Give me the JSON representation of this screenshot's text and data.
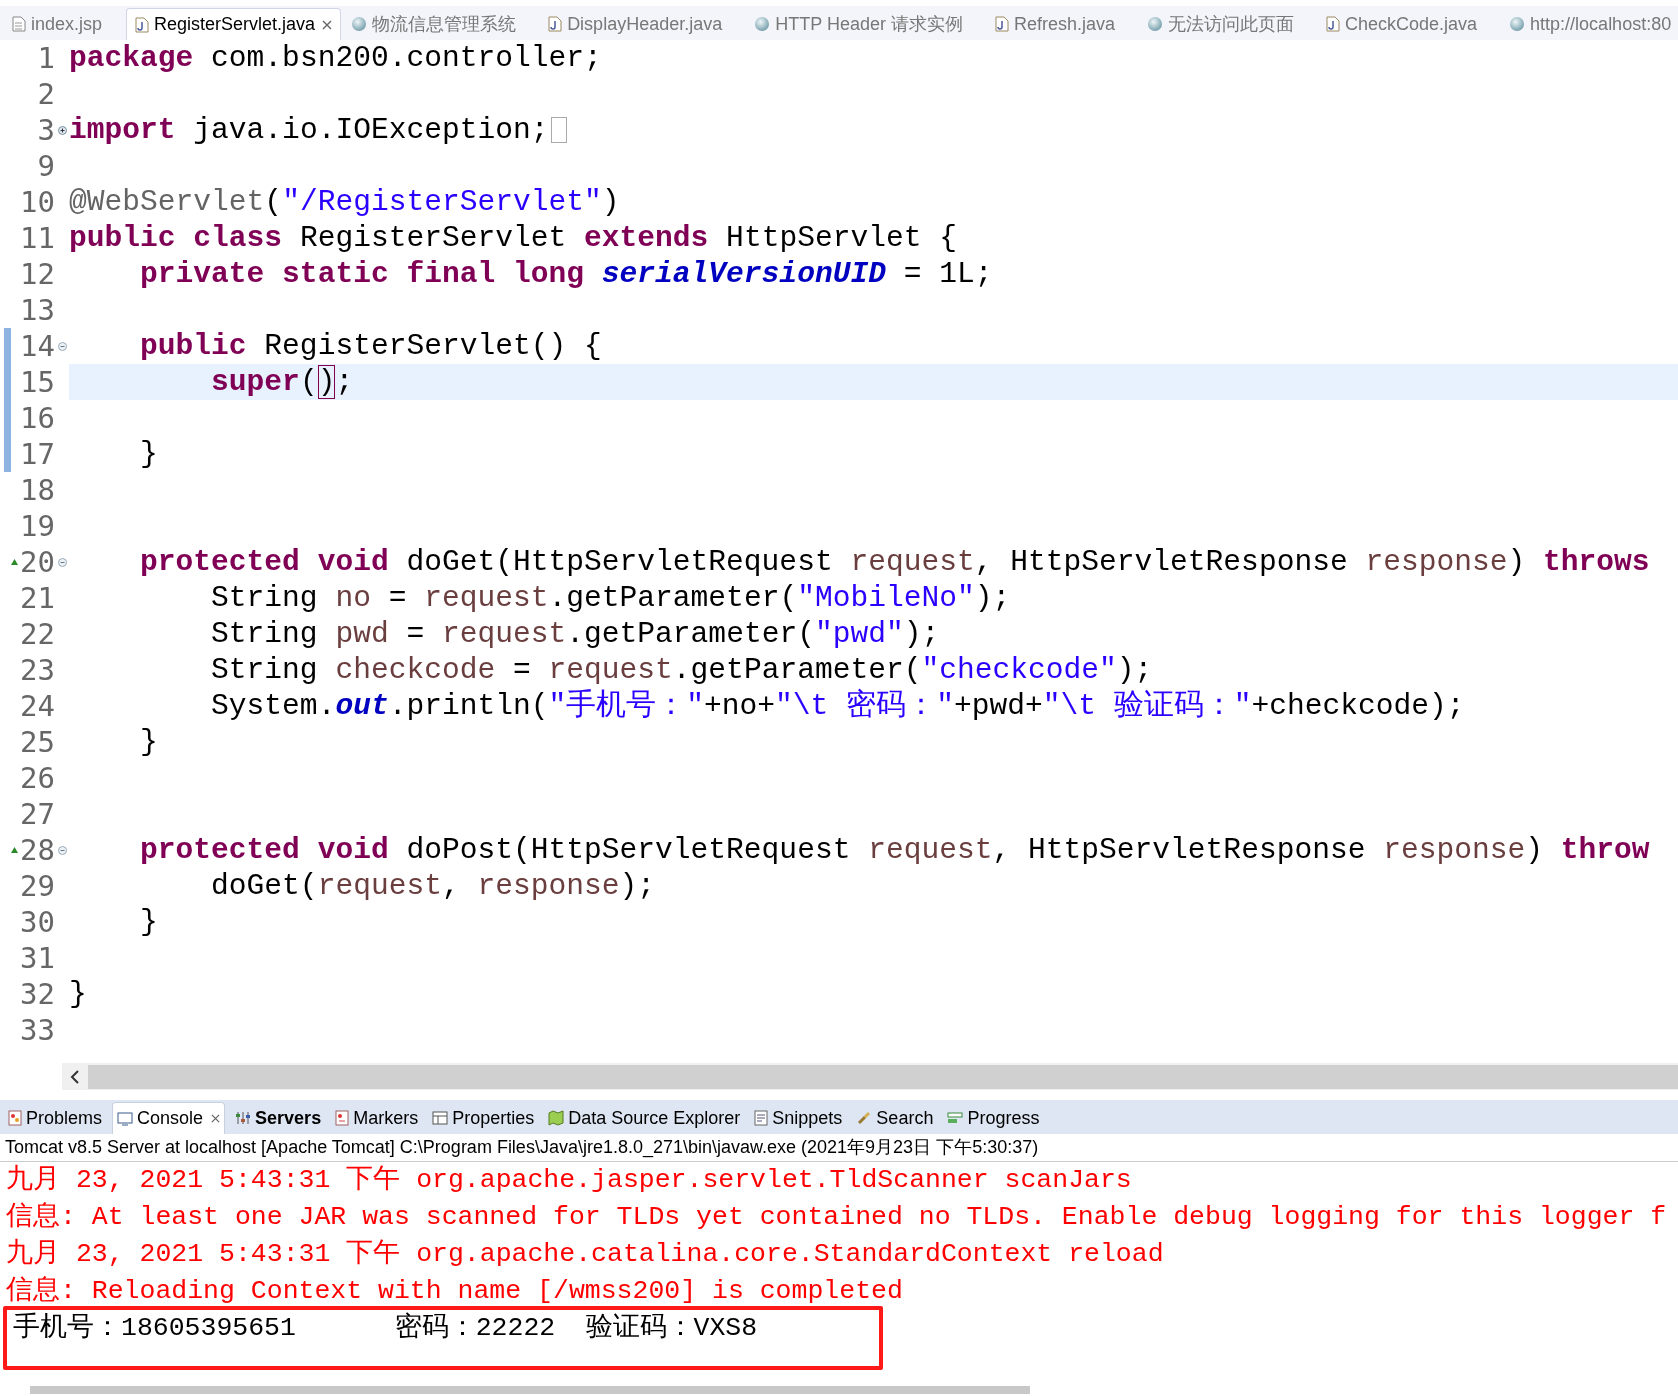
{
  "editor_tabs": [
    {
      "label": "index.jsp",
      "kind": "jsp",
      "selected": false,
      "closable": false
    },
    {
      "label": "RegisterServlet.java",
      "kind": "java",
      "selected": true,
      "closable": true
    },
    {
      "label": "物流信息管理系统",
      "kind": "web",
      "selected": false,
      "closable": false
    },
    {
      "label": "DisplayHeader.java",
      "kind": "java",
      "selected": false,
      "closable": false
    },
    {
      "label": "HTTP Header 请求实例",
      "kind": "web",
      "selected": false,
      "closable": false
    },
    {
      "label": "Refresh.java",
      "kind": "java",
      "selected": false,
      "closable": false
    },
    {
      "label": "无法访问此页面",
      "kind": "web",
      "selected": false,
      "closable": false
    },
    {
      "label": "CheckCode.java",
      "kind": "java",
      "selected": false,
      "closable": false
    },
    {
      "label": "http://localhost:80",
      "kind": "web",
      "selected": false,
      "closable": false
    }
  ],
  "code_lines": [
    {
      "n": "1",
      "current": false,
      "changed": false,
      "override": false,
      "tokens": [
        {
          "kind": "kw",
          "text": "package"
        },
        {
          "kind": "plain",
          "text": " com.bsn200.controller;"
        }
      ]
    },
    {
      "n": "2",
      "current": false,
      "changed": false,
      "override": false
    },
    {
      "n": "3",
      "current": false,
      "changed": false,
      "override": false,
      "collapsed": true,
      "tokens": [
        {
          "kind": "kw",
          "text": "import"
        },
        {
          "kind": "plain",
          "text": " java.io.IOException;"
        }
      ]
    },
    {
      "n": "9",
      "current": false,
      "changed": false,
      "override": false
    },
    {
      "n": "10",
      "current": false,
      "changed": false,
      "override": false,
      "tokens": [
        {
          "kind": "ann",
          "text": "@WebServlet"
        },
        {
          "kind": "plain",
          "text": "("
        },
        {
          "kind": "str",
          "text": "\"/RegisterServlet\""
        },
        {
          "kind": "plain",
          "text": ")"
        }
      ]
    },
    {
      "n": "11",
      "current": false,
      "changed": false,
      "override": false,
      "tokens": [
        {
          "kind": "kw",
          "text": "public class"
        },
        {
          "kind": "plain",
          "text": " RegisterServlet "
        },
        {
          "kind": "kw",
          "text": "extends"
        },
        {
          "kind": "plain",
          "text": " HttpServlet {"
        }
      ]
    },
    {
      "n": "12",
      "current": false,
      "changed": false,
      "override": false,
      "tokens": [
        {
          "kind": "kw",
          "text": "    private static final long"
        },
        {
          "kind": "field",
          "text": " serialVersionUID"
        },
        {
          "kind": "plain",
          "text": " = 1L;"
        }
      ]
    },
    {
      "n": "13",
      "current": false,
      "changed": false,
      "override": false
    },
    {
      "n": "14",
      "current": false,
      "changed": true,
      "override": false,
      "collapsed": false,
      "tokens": [
        {
          "kind": "kw",
          "text": "    public"
        },
        {
          "kind": "plain",
          "text": " RegisterServlet() {"
        }
      ]
    },
    {
      "n": "15",
      "current": true,
      "changed": true,
      "override": false,
      "tokens": [
        {
          "kind": "kw",
          "text": "        super"
        },
        {
          "kind": "plain",
          "text": "("
        },
        {
          "kind": "match",
          "text": ")"
        },
        {
          "kind": "plain",
          "text": ";"
        }
      ]
    },
    {
      "n": "16",
      "current": false,
      "changed": true,
      "override": false
    },
    {
      "n": "17",
      "current": false,
      "changed": true,
      "override": false,
      "tokens": [
        {
          "kind": "plain",
          "text": "    }"
        }
      ]
    },
    {
      "n": "18",
      "current": false,
      "changed": false,
      "override": false
    },
    {
      "n": "19",
      "current": false,
      "changed": false,
      "override": false
    },
    {
      "n": "20",
      "current": false,
      "changed": false,
      "override": true,
      "collapsed": false,
      "tokens": [
        {
          "kind": "kw",
          "text": "    protected void"
        },
        {
          "kind": "plain",
          "text": " doGet(HttpServletRequest"
        },
        {
          "kind": "var",
          "text": " request"
        },
        {
          "kind": "plain",
          "text": ", HttpServletResponse"
        },
        {
          "kind": "var",
          "text": " response"
        },
        {
          "kind": "plain",
          "text": ")"
        },
        {
          "kind": "kw",
          "text": " throws"
        }
      ]
    },
    {
      "n": "21",
      "current": false,
      "changed": false,
      "override": false,
      "tokens": [
        {
          "kind": "plain",
          "text": "        String"
        },
        {
          "kind": "var",
          "text": " no"
        },
        {
          "kind": "plain",
          "text": " ="
        },
        {
          "kind": "var",
          "text": " request"
        },
        {
          "kind": "plain",
          "text": ".getParameter("
        },
        {
          "kind": "str",
          "text": "\"MobileNo\""
        },
        {
          "kind": "plain",
          "text": ");"
        }
      ]
    },
    {
      "n": "22",
      "current": false,
      "changed": false,
      "override": false,
      "tokens": [
        {
          "kind": "plain",
          "text": "        String"
        },
        {
          "kind": "var",
          "text": " pwd"
        },
        {
          "kind": "plain",
          "text": " ="
        },
        {
          "kind": "var",
          "text": " request"
        },
        {
          "kind": "plain",
          "text": ".getParameter("
        },
        {
          "kind": "str",
          "text": "\"pwd\""
        },
        {
          "kind": "plain",
          "text": ");"
        }
      ]
    },
    {
      "n": "23",
      "current": false,
      "changed": false,
      "override": false,
      "tokens": [
        {
          "kind": "plain",
          "text": "        String"
        },
        {
          "kind": "var",
          "text": " checkcode"
        },
        {
          "kind": "plain",
          "text": " ="
        },
        {
          "kind": "var",
          "text": " request"
        },
        {
          "kind": "plain",
          "text": ".getParameter("
        },
        {
          "kind": "str",
          "text": "\"checkcode\""
        },
        {
          "kind": "plain",
          "text": ");"
        }
      ]
    },
    {
      "n": "24",
      "current": false,
      "changed": false,
      "override": false,
      "tokens": [
        {
          "kind": "plain",
          "text": "        System."
        },
        {
          "kind": "field",
          "text": "out"
        },
        {
          "kind": "plain",
          "text": ".println("
        },
        {
          "kind": "str",
          "text": "\"手机号：\""
        },
        {
          "kind": "plain",
          "text": "+no+"
        },
        {
          "kind": "str",
          "text": "\"\\t 密码：\""
        },
        {
          "kind": "plain",
          "text": "+pwd+"
        },
        {
          "kind": "str",
          "text": "\"\\t 验证码：\""
        },
        {
          "kind": "plain",
          "text": "+checkcode);"
        }
      ]
    },
    {
      "n": "25",
      "current": false,
      "changed": false,
      "override": false,
      "tokens": [
        {
          "kind": "plain",
          "text": "    }"
        }
      ]
    },
    {
      "n": "26",
      "current": false,
      "changed": false,
      "override": false
    },
    {
      "n": "27",
      "current": false,
      "changed": false,
      "override": false
    },
    {
      "n": "28",
      "current": false,
      "changed": false,
      "override": true,
      "collapsed": false,
      "tokens": [
        {
          "kind": "kw",
          "text": "    protected void"
        },
        {
          "kind": "plain",
          "text": " doPost(HttpServletRequest"
        },
        {
          "kind": "var",
          "text": " request"
        },
        {
          "kind": "plain",
          "text": ", HttpServletResponse"
        },
        {
          "kind": "var",
          "text": " response"
        },
        {
          "kind": "plain",
          "text": ")"
        },
        {
          "kind": "kw",
          "text": " throw"
        }
      ]
    },
    {
      "n": "29",
      "current": false,
      "changed": false,
      "override": false,
      "tokens": [
        {
          "kind": "plain",
          "text": "        doGet("
        },
        {
          "kind": "var",
          "text": "request"
        },
        {
          "kind": "plain",
          "text": ","
        },
        {
          "kind": "var",
          "text": " response"
        },
        {
          "kind": "plain",
          "text": ");"
        }
      ]
    },
    {
      "n": "30",
      "current": false,
      "changed": false,
      "override": false,
      "tokens": [
        {
          "kind": "plain",
          "text": "    }"
        }
      ]
    },
    {
      "n": "31",
      "current": false,
      "changed": false,
      "override": false
    },
    {
      "n": "32",
      "current": false,
      "changed": false,
      "override": false,
      "tokens": [
        {
          "kind": "plain",
          "text": "}"
        }
      ]
    },
    {
      "n": "33",
      "current": false,
      "changed": false,
      "override": false
    }
  ],
  "view_tabs": [
    {
      "label": "Problems",
      "selected": false,
      "bold": false,
      "closable": false
    },
    {
      "label": "Console",
      "selected": true,
      "bold": false,
      "closable": true
    },
    {
      "label": "Servers",
      "selected": false,
      "bold": true,
      "closable": false
    },
    {
      "label": "Markers",
      "selected": false,
      "bold": false,
      "closable": false
    },
    {
      "label": "Properties",
      "selected": false,
      "bold": false,
      "closable": false
    },
    {
      "label": "Data Source Explorer",
      "selected": false,
      "bold": false,
      "closable": false
    },
    {
      "label": "Snippets",
      "selected": false,
      "bold": false,
      "closable": false
    },
    {
      "label": "Search",
      "selected": false,
      "bold": false,
      "closable": false
    },
    {
      "label": "Progress",
      "selected": false,
      "bold": false,
      "closable": false
    }
  ],
  "console": {
    "header": "Tomcat v8.5 Server at localhost [Apache Tomcat] C:\\Program Files\\Java\\jre1.8.0_271\\bin\\javaw.exe (2021年9月23日 下午5:30:37)",
    "lines": [
      {
        "kind": "err",
        "highlighted": false,
        "text": "九月 23, 2021 5:43:31 下午 org.apache.jasper.servlet.TldScanner scanJars"
      },
      {
        "kind": "err",
        "highlighted": false,
        "text": "信息: At least one JAR was scanned for TLDs yet contained no TLDs. Enable debug logging for this logger f"
      },
      {
        "kind": "err",
        "highlighted": false,
        "text": "九月 23, 2021 5:43:31 下午 org.apache.catalina.core.StandardContext reload"
      },
      {
        "kind": "err",
        "highlighted": false,
        "text": "信息: Reloading Context with name [/wmss200] is completed"
      },
      {
        "kind": "out",
        "highlighted": true,
        "text": "手机号：18605395651\t密码：22222\t验证码：VXS8"
      }
    ]
  }
}
